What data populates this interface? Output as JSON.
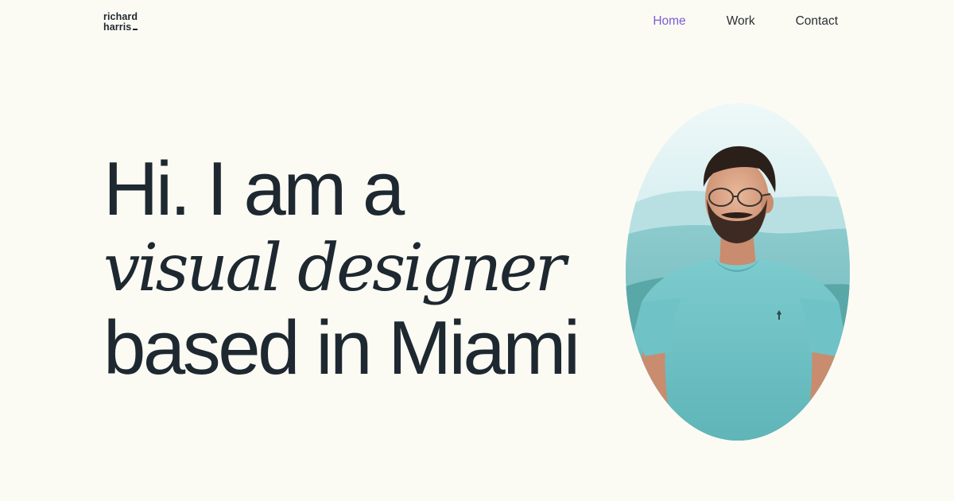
{
  "brand": {
    "line1": "richard",
    "line2": "harris"
  },
  "nav": {
    "items": [
      {
        "label": "Home",
        "active": true
      },
      {
        "label": "Work",
        "active": false
      },
      {
        "label": "Contact",
        "active": false
      }
    ]
  },
  "hero": {
    "line1": "Hi. I am a",
    "line2": "visual designer",
    "line3": "based in Miami"
  },
  "colors": {
    "background": "#fbfbf4",
    "text": "#1e2830",
    "accent": "#7b5bd6",
    "shirt": "#6ec1c4",
    "sky": "#dff2f3"
  },
  "portrait": {
    "subject": "man-in-teal-tshirt-with-glasses"
  }
}
